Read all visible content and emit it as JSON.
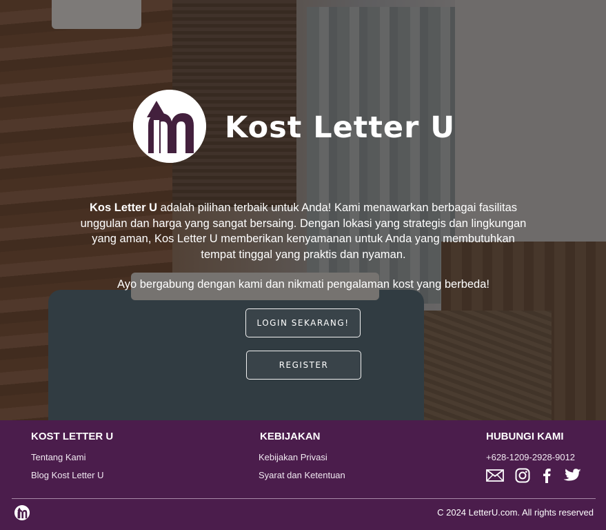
{
  "hero": {
    "brand_name": "Kost Letter U",
    "intro_bold": "Kos Letter U",
    "intro_text": " adalah pilihan terbaik untuk Anda! Kami menawarkan berbagai fasilitas unggulan dan harga yang sangat bersaing. Dengan lokasi yang strategis dan lingkungan yang aman, Kos Letter U memberikan kenyamanan untuk Anda yang membutuhkan tempat tinggal yang praktis dan nyaman.",
    "invite_text": "Ayo bergabung dengan kami dan nikmati pengalaman kost yang berbeda!",
    "login_label": "LOGIN SEKARANG!",
    "register_label": "REGISTER"
  },
  "footer": {
    "col1": {
      "title": "KOST LETTER U",
      "links": [
        "Tentang Kami",
        "Blog Kost Letter U"
      ]
    },
    "col2": {
      "title": "KEBIJAKAN",
      "links": [
        "Kebijakan Privasi",
        "Syarat dan Ketentuan"
      ]
    },
    "col3": {
      "title": "HUBUNGI KAMI",
      "phone": "+628-1209-2928-9012"
    },
    "social_icons": [
      "mail-icon",
      "instagram-icon",
      "facebook-icon",
      "twitter-icon"
    ],
    "copyright": "C 2024 LetterU.com. All rights reserved"
  },
  "colors": {
    "footer_bg": "#4b1d4c",
    "text": "#ffffff",
    "divider": "#a98aa9"
  }
}
